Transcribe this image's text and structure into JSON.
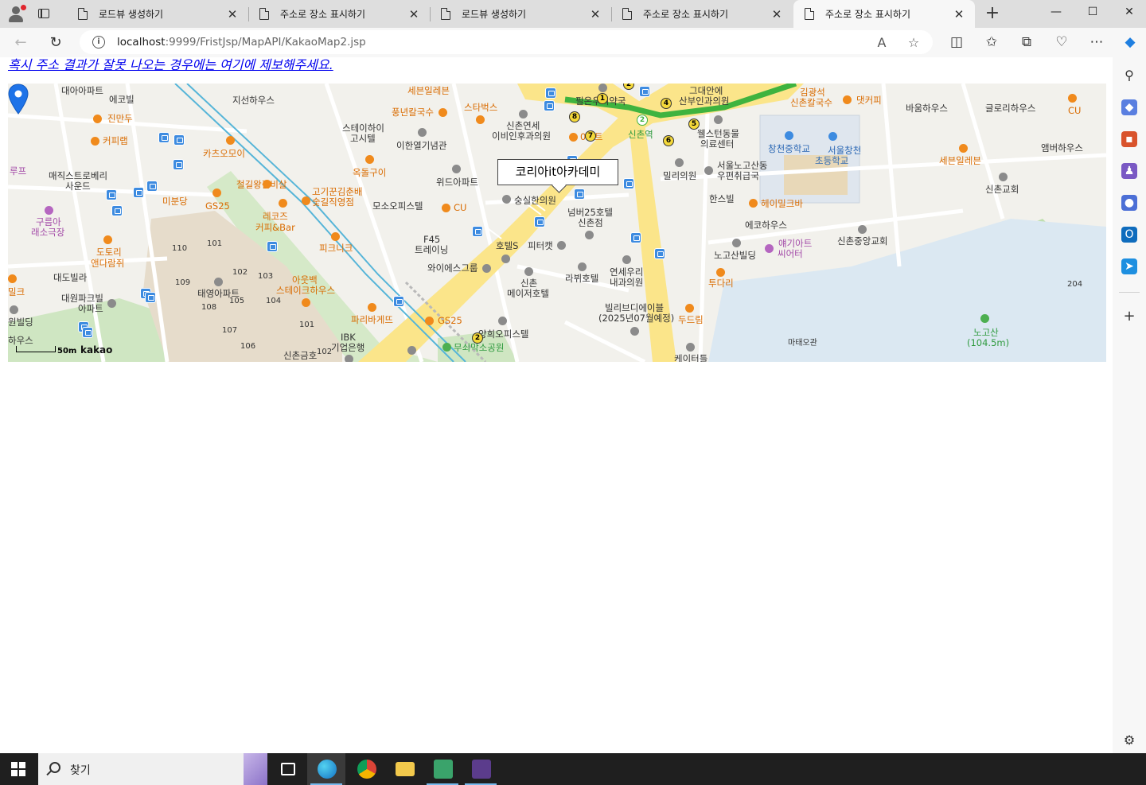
{
  "browser": {
    "tabs": [
      {
        "title": "로드뷰 생성하기",
        "active": false
      },
      {
        "title": "주소로 장소 표시하기",
        "active": false
      },
      {
        "title": "로드뷰 생성하기",
        "active": false
      },
      {
        "title": "주소로 장소 표시하기",
        "active": false
      },
      {
        "title": "주소로 장소 표시하기",
        "active": true
      }
    ],
    "url_host": "localhost",
    "url_rest": ":9999/FristJsp/MapAPI/KakaoMap2.jsp",
    "new_tab_symbol": "+",
    "close_symbol": "✕",
    "minimize_symbol": "—",
    "maximize_symbol": "☐",
    "window_close_symbol": "✕"
  },
  "page": {
    "report_link": "혹시 주소 결과가 잘못 나오는 경우에는 여기에 제보해주세요."
  },
  "map": {
    "infowindow_text": "코리아it아카데미",
    "scale_label": "50m",
    "provider": "kakao",
    "labels": {
      "l1": "대아아파트",
      "l2": "에코빌",
      "l3": "지선하우스",
      "l4": "세븐일레븐",
      "l5": "그대안에",
      "l6": "산부인과의원",
      "l7": "김광석",
      "l8": "신촌칼국수",
      "l9": "댓커피",
      "l10": "바움하우스",
      "l11": "글로리하우스",
      "l12": "CU",
      "l13": "진만두",
      "l14": "풍년칼국수",
      "l15": "스타벅스",
      "l16": "신촌연세",
      "l17": "이비인후과의원",
      "l18": "신촌역",
      "l19": "웰스턴동물",
      "l20": "의료센터",
      "l21": "창천중학교",
      "l22": "서울창천",
      "l23": "초등학교",
      "l24": "앰버하우스",
      "l25": "커피랩",
      "l26": "스테이하이",
      "l27": "고시텔",
      "l28": "이한열기념관",
      "l29": "카츠오모이",
      "l30": "밀리의원",
      "l31": "서울노고산동",
      "l32": "우편취급국",
      "l33": "세븐일레븐",
      "l34": "매직스트로베리",
      "l35": "사운드",
      "l36": "옥돌구이",
      "l37": "위드아파트",
      "l38": "철길왕갈비살",
      "l39": "고기꾼김춘배",
      "l40": "숯길직영점",
      "l41": "신촌교회",
      "l42": "구름아",
      "l43": "래소극장",
      "l44": "미분당",
      "l45": "GS25",
      "l46": "모소오피스텔",
      "l47": "CU",
      "l48": "숭실한의원",
      "l49": "넘버25호텔",
      "l50": "신촌점",
      "l51": "한스빌",
      "l52": "헤이밀크바",
      "l53": "레코즈",
      "l54": "커피&Bar",
      "l55": "에코하우스",
      "l56": "도토리",
      "l57": "앤다람쥐",
      "l58": "101",
      "l59": "110",
      "l60": "피크니크",
      "l61": "F45",
      "l62": "트레이닝",
      "l63": "호텔S",
      "l64": "피터캣",
      "l65": "얘기아트",
      "l66": "씨어터",
      "l67": "노고산빌딩",
      "l68": "신촌중앙교회",
      "l69": "102",
      "l70": "103",
      "l71": "와이에스그룹",
      "l72": "연세우리",
      "l73": "내과의원",
      "l74": "라뷔호텔",
      "l75": "대도빌라",
      "l76": "109",
      "l77": "아웃백",
      "l78": "스테이크하우스",
      "l79": "신촌",
      "l80": "메이저호텔",
      "l81": "투다리",
      "l82": "대원파크빌",
      "l83": "아파트",
      "l84": "태영아파트",
      "l85": "105",
      "l86": "104",
      "l87": "108",
      "l88": "빌리브디에이블",
      "l89": "(2025년07월예정)",
      "l90": "파리바게뜨",
      "l91": "두드림",
      "l92": "원빌딩",
      "l93": "GS25",
      "l94": "101",
      "l95": "107",
      "l96": "노고산",
      "l97": "(104.5m)",
      "l98": "IBK",
      "l99": "기업은행",
      "l100": "양희오피스텔",
      "l101": "마태오관",
      "l102": "하우스",
      "l103": "106",
      "l104": "무쇠막소공원",
      "l105": "신촌금호",
      "l106": "102",
      "l107": "케이터틀",
      "l108": "루프",
      "l109": "밀크",
      "l110": "필온우리약국",
      "l111": "0마트",
      "l112": "204"
    }
  },
  "taskbar": {
    "search_placeholder": "찾기"
  }
}
